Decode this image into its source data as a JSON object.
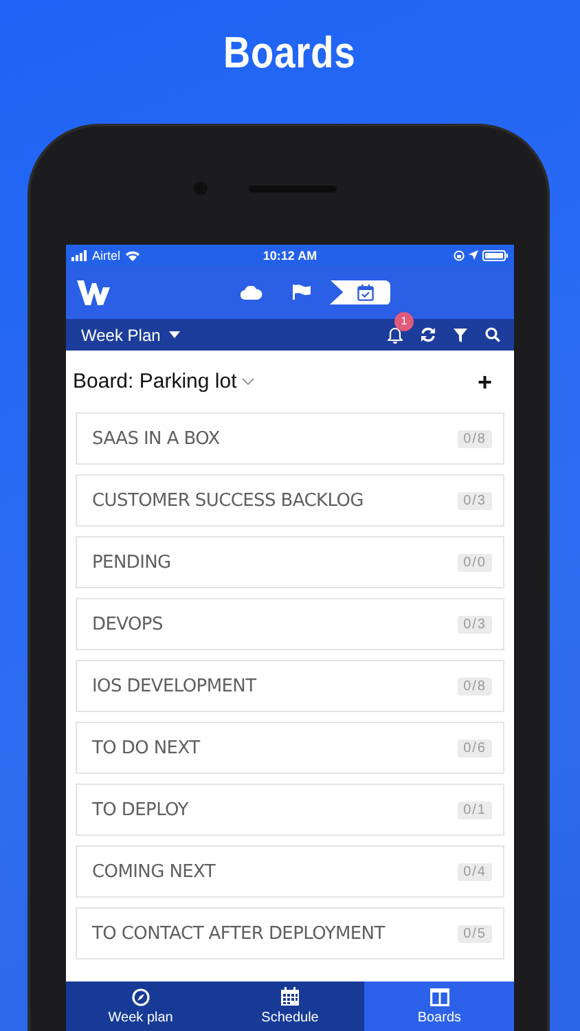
{
  "title": "Boards",
  "status_bar": {
    "carrier": "Airtel",
    "time": "10:12 AM"
  },
  "header_tabs": [
    {
      "kind": "cloud",
      "selected": false
    },
    {
      "kind": "flag",
      "selected": false
    },
    {
      "kind": "calendar",
      "selected": true
    }
  ],
  "toolbar": {
    "view": "Week Plan",
    "notification_count": "1"
  },
  "board": {
    "title": "Board: Parking lot",
    "add": "+"
  },
  "lists": [
    {
      "name": "SAAS IN A BOX",
      "count": "0/8"
    },
    {
      "name": "CUSTOMER SUCCESS BACKLOG",
      "count": "0/3"
    },
    {
      "name": "PENDING",
      "count": "0/0"
    },
    {
      "name": "DEVOPS",
      "count": "0/3"
    },
    {
      "name": "IOS DEVELOPMENT",
      "count": "0/8"
    },
    {
      "name": "TO DO NEXT",
      "count": "0/6"
    },
    {
      "name": "TO DEPLOY",
      "count": "0/1"
    },
    {
      "name": "COMING NEXT",
      "count": "0/4"
    },
    {
      "name": "TO CONTACT AFTER DEPLOYMENT",
      "count": "0/5"
    }
  ],
  "nav": [
    {
      "kind": "compass",
      "label": "Week plan",
      "selected": false
    },
    {
      "kind": "calendar",
      "label": "Schedule",
      "selected": false
    },
    {
      "kind": "columns",
      "label": "Boards",
      "selected": true
    }
  ]
}
